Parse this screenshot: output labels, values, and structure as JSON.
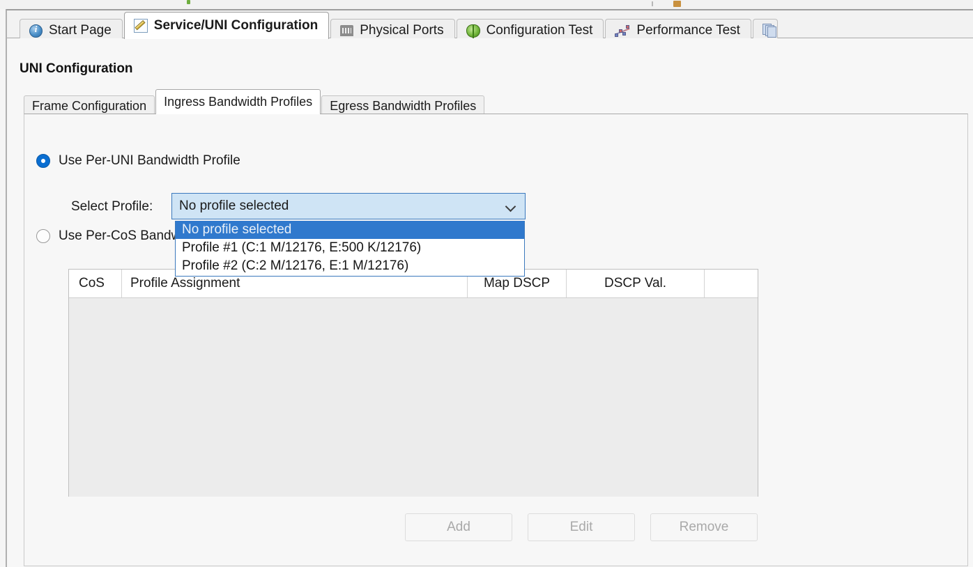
{
  "window": {
    "main_tabs": [
      {
        "label": "Start Page",
        "icon": "info-icon",
        "active": false
      },
      {
        "label": "Service/UNI Configuration",
        "icon": "pencil-icon",
        "active": true
      },
      {
        "label": "Physical Ports",
        "icon": "port-icon",
        "active": false
      },
      {
        "label": "Configuration Test",
        "icon": "bug-icon",
        "active": false
      },
      {
        "label": "Performance Test",
        "icon": "performance-chart-icon",
        "active": false
      },
      {
        "label": "",
        "icon": "layers-icon",
        "active": false
      }
    ]
  },
  "page": {
    "title": "UNI Configuration",
    "sub_tabs": [
      {
        "label": "Frame Configuration",
        "active": false
      },
      {
        "label": "Ingress Bandwidth Profiles",
        "active": true
      },
      {
        "label": "Egress Bandwidth Profiles",
        "active": false
      }
    ]
  },
  "form": {
    "radio_per_uni": {
      "label": "Use Per-UNI Bandwidth Profile",
      "checked": true
    },
    "radio_per_cos": {
      "label": "Use Per-CoS Bandwidth Profiles",
      "checked": false
    },
    "select_profile_label": "Select Profile:",
    "combo": {
      "value": "No profile selected",
      "expanded": true,
      "options": [
        "No profile selected",
        "Profile #1 (C:1 M/12176, E:500 K/12176)",
        "Profile #2 (C:2 M/12176, E:1 M/12176)"
      ],
      "selected_index": 0
    }
  },
  "table": {
    "columns": [
      "CoS",
      "Profile Assignment",
      "Map DSCP",
      "DSCP Val.",
      ""
    ],
    "rows": []
  },
  "buttons": {
    "add": "Add",
    "edit": "Edit",
    "remove": "Remove"
  },
  "colors": {
    "accent_blue": "#0a6ed1",
    "highlight_blue": "#3079cd",
    "combo_focus_bg": "#cfe4f5",
    "table_body_bg": "#ececec"
  }
}
